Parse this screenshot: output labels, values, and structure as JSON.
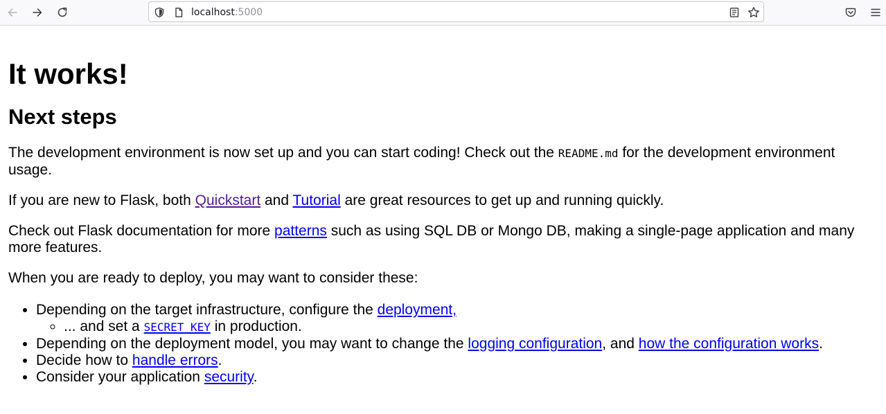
{
  "browser": {
    "url_host": "localhost",
    "url_port": ":5000",
    "icons": {
      "back": "back-arrow-icon",
      "forward": "forward-arrow-icon",
      "reload": "reload-icon",
      "tracking_protection": "shield-icon",
      "page_info": "page-icon",
      "reader_view": "reader-view-icon",
      "bookmark": "star-icon",
      "pocket": "pocket-icon",
      "menu": "hamburger-menu-icon"
    }
  },
  "page": {
    "title": "It works!",
    "subtitle": "Next steps",
    "p1": {
      "before": "The development environment is now set up and you can start coding! Check out the ",
      "code": "README.md",
      "after": " for the development environment usage."
    },
    "p2": {
      "before": "If you are new to Flask, both ",
      "link1": "Quickstart",
      "middle": " and ",
      "link2": "Tutorial",
      "after": " are great resources to get up and running quickly."
    },
    "p3": {
      "before": "Check out Flask documentation for more ",
      "link": "patterns",
      "after": " such as using SQL DB or Mongo DB, making a single-page application and many more features."
    },
    "p4": "When you are ready to deploy, you may want to consider these:",
    "list": {
      "item1": {
        "before": "Depending on the target infrastructure, configure the ",
        "link": "deployment,",
        "sub": {
          "before": "... and set a ",
          "link_code": "SECRET_KEY",
          "after": " in production."
        }
      },
      "item2": {
        "before": "Depending on the deployment model, you may want to change the ",
        "link1": "logging configuration",
        "middle": ", and ",
        "link2": "how the configuration works",
        "after": "."
      },
      "item3": {
        "before": "Decide how to ",
        "link": "handle errors",
        "after": "."
      },
      "item4": {
        "before": "Consider your application ",
        "link": "security",
        "after": "."
      }
    }
  }
}
